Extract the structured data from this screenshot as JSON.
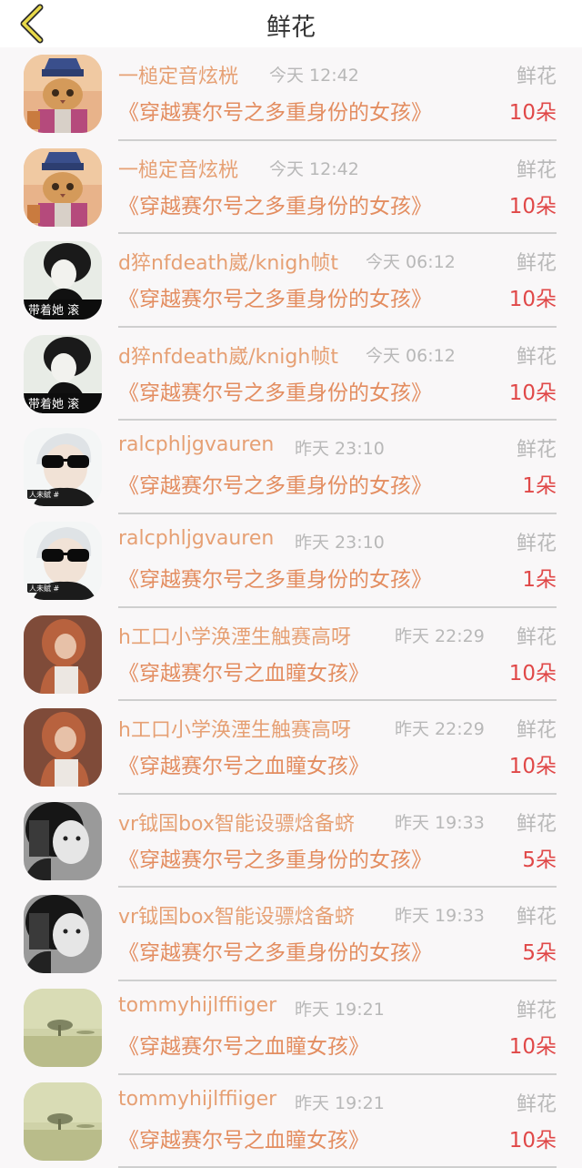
{
  "header": {
    "title": "鲜花"
  },
  "colors": {
    "accent": "#e6a074",
    "count": "#e04848",
    "muted": "#b8b8b8"
  },
  "rows": [
    {
      "name": "一槌定音炫桄",
      "time": "今天 12:42",
      "gift": "鲜花",
      "book": "《穿越赛尔号之多重身份的女孩》",
      "count": "10朵",
      "avatar": "cat-warrior"
    },
    {
      "name": "一槌定音炫桄",
      "time": "今天 12:42",
      "gift": "鲜花",
      "book": "《穿越赛尔号之多重身份的女孩》",
      "count": "10朵",
      "avatar": "cat-warrior"
    },
    {
      "name": "d猝nfdeath崴/knigh帧t",
      "time": "今天 06:12",
      "gift": "鲜花",
      "book": "《穿越赛尔号之多重身份的女孩》",
      "count": "10朵",
      "avatar": "bw-girl",
      "avatar_caption": "带着她 滚"
    },
    {
      "name": "d猝nfdeath崴/knigh帧t",
      "time": "今天 06:12",
      "gift": "鲜花",
      "book": "《穿越赛尔号之多重身份的女孩》",
      "count": "10朵",
      "avatar": "bw-girl",
      "avatar_caption": "带着她 滚"
    },
    {
      "name": "ralcphljgvauren",
      "time": "昨天 23:10",
      "gift": "鲜花",
      "book": "《穿越赛尔号之多重身份的女孩》",
      "count": "1朵",
      "avatar": "sunglasses-guy",
      "avatar_caption": "人未赋 #"
    },
    {
      "name": "ralcphljgvauren",
      "time": "昨天 23:10",
      "gift": "鲜花",
      "book": "《穿越赛尔号之多重身份的女孩》",
      "count": "1朵",
      "avatar": "sunglasses-guy",
      "avatar_caption": "人未赋 #"
    },
    {
      "name": "h工口小学涣湮生触赛高呀",
      "time": "昨天 22:29",
      "gift": "鲜花",
      "book": "《穿越赛尔号之血瞳女孩》",
      "count": "10朵",
      "avatar": "redhead-girl"
    },
    {
      "name": "h工口小学涣湮生触赛高呀",
      "time": "昨天 22:29",
      "gift": "鲜花",
      "book": "《穿越赛尔号之血瞳女孩》",
      "count": "10朵",
      "avatar": "redhead-girl"
    },
    {
      "name": "vr钺国box智能设骠焓备蛴",
      "time": "昨天 19:33",
      "gift": "鲜花",
      "book": "《穿越赛尔号之多重身份的女孩》",
      "count": "5朵",
      "avatar": "bw-woman"
    },
    {
      "name": "vr钺国box智能设骠焓备蛴",
      "time": "昨天 19:33",
      "gift": "鲜花",
      "book": "《穿越赛尔号之多重身份的女孩》",
      "count": "5朵",
      "avatar": "bw-woman"
    },
    {
      "name": "tommyhijlffiiger",
      "time": "昨天 19:21",
      "gift": "鲜花",
      "book": "《穿越赛尔号之血瞳女孩》",
      "count": "10朵",
      "avatar": "foggy-tree"
    },
    {
      "name": "tommyhijlffiiger",
      "time": "昨天 19:21",
      "gift": "鲜花",
      "book": "《穿越赛尔号之血瞳女孩》",
      "count": "10朵",
      "avatar": "foggy-tree"
    }
  ]
}
